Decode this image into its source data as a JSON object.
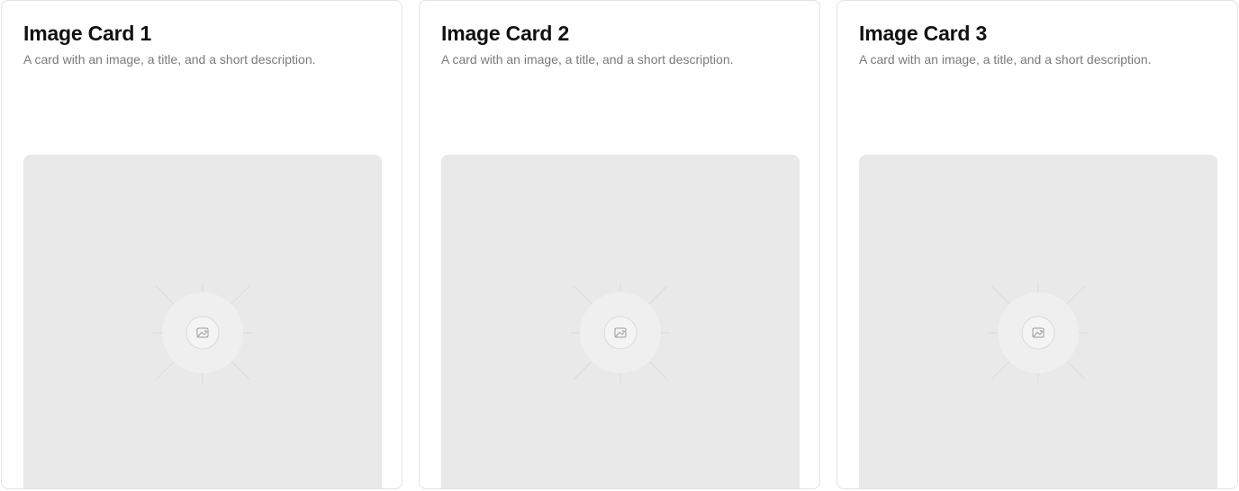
{
  "cards": [
    {
      "title": "Image Card 1",
      "description": "A card with an image, a title, and a short description.",
      "image_icon": "image-icon"
    },
    {
      "title": "Image Card 2",
      "description": "A card with an image, a title, and a short description.",
      "image_icon": "image-icon"
    },
    {
      "title": "Image Card 3",
      "description": "A card with an image, a title, and a short description.",
      "image_icon": "image-icon"
    }
  ],
  "colors": {
    "card_border": "#e3e3e3",
    "title": "#111111",
    "description": "#7a7a7a",
    "image_background": "#e9e9e9"
  }
}
